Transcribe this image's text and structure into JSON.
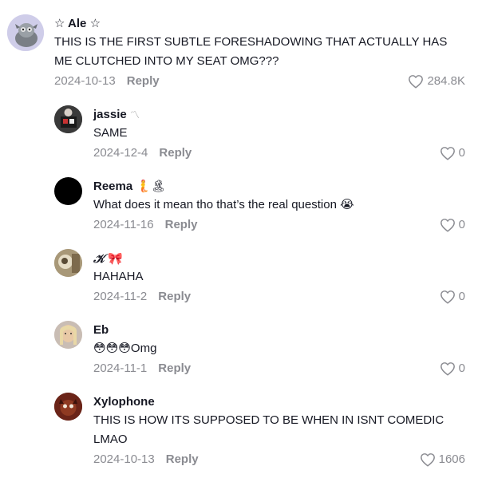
{
  "comments": [
    {
      "username": "☆ Ale ☆",
      "text": "THIS IS THE FIRST SUBTLE FORESHADOWING THAT ACTUALLY HAS ME CLUTCHED INTO MY SEAT OMG???",
      "date": "2024-10-13",
      "reply_label": "Reply",
      "likes": "284.8K"
    },
    {
      "username": "jassie",
      "username_emoji": "〽",
      "text": "SAME",
      "date": "2024-12-4",
      "reply_label": "Reply",
      "likes": "0"
    },
    {
      "username": "Reema",
      "username_emoji": "🧜🏝",
      "text": "What does it mean tho that’s the real question",
      "text_emoji": "😭",
      "date": "2024-11-16",
      "reply_label": "Reply",
      "likes": "0"
    },
    {
      "username": "𝒦",
      "username_emoji": "🎀",
      "text": "HAHAHA",
      "date": "2024-11-2",
      "reply_label": "Reply",
      "likes": "0"
    },
    {
      "username": "Eb",
      "text": "Omg",
      "text_prefix_emoji": "😳😳😳",
      "date": "2024-11-1",
      "reply_label": "Reply",
      "likes": "0"
    },
    {
      "username": "Xylophone",
      "text": "THIS IS HOW ITS SUPPOSED TO BE WHEN IN ISNT COMEDIC LMAO",
      "date": "2024-10-13",
      "reply_label": "Reply",
      "likes": "1606"
    }
  ],
  "icons": {
    "like": "heart-outline-icon"
  },
  "colors": {
    "text": "#161823",
    "meta": "#8a8b91"
  }
}
